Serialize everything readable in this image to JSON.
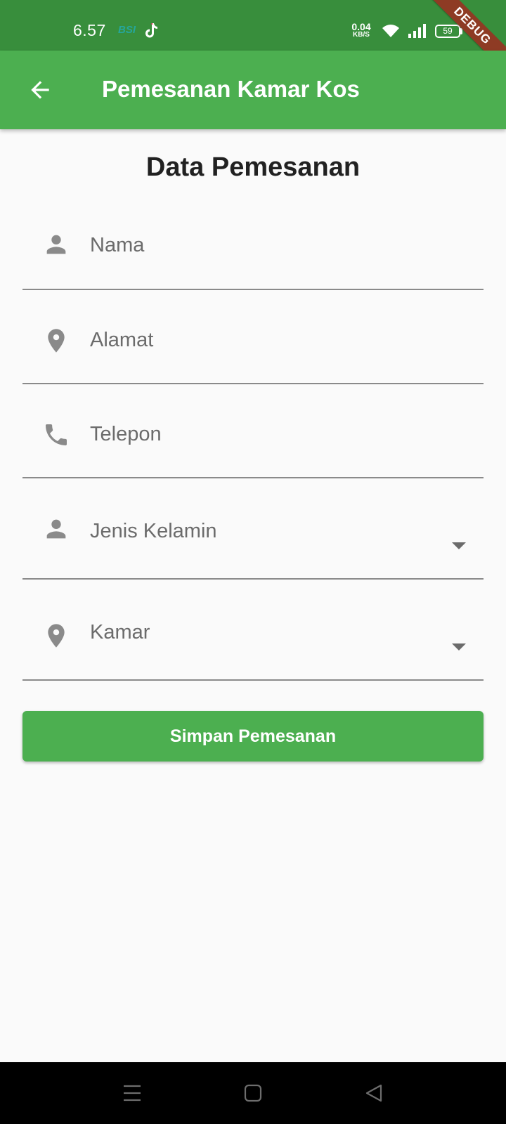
{
  "status_bar": {
    "time": "6.57",
    "bsi_label": "BSI",
    "net_speed_value": "0.04",
    "net_speed_unit": "KB/S",
    "battery": "59",
    "debug_banner": "DEBUG",
    "icons": [
      "bsi-icon",
      "tiktok-icon",
      "wifi-icon",
      "signal-icon",
      "battery-icon",
      "charging-icon"
    ]
  },
  "app_bar": {
    "title": "Pemesanan Kamar Kos",
    "back_icon": "arrow-back-icon",
    "color": "#4caf50"
  },
  "form": {
    "heading": "Data Pemesanan",
    "fields": [
      {
        "label": "Nama",
        "icon": "person-icon",
        "type": "text"
      },
      {
        "label": "Alamat",
        "icon": "location-pin-icon",
        "type": "text"
      },
      {
        "label": "Telepon",
        "icon": "phone-icon",
        "type": "text"
      },
      {
        "label": "Jenis Kelamin",
        "icon": "person-icon",
        "type": "dropdown"
      },
      {
        "label": "Kamar",
        "icon": "location-pin-icon",
        "type": "dropdown"
      }
    ],
    "submit_label": "Simpan Pemesanan"
  },
  "nav_bar": {
    "icons": [
      "menu-icon",
      "home-icon",
      "back-triangle-icon"
    ]
  },
  "colors": {
    "primary": "#4caf50",
    "status_bar": "#388e3c",
    "background": "#fafafa",
    "debug": "#8e3b24"
  }
}
